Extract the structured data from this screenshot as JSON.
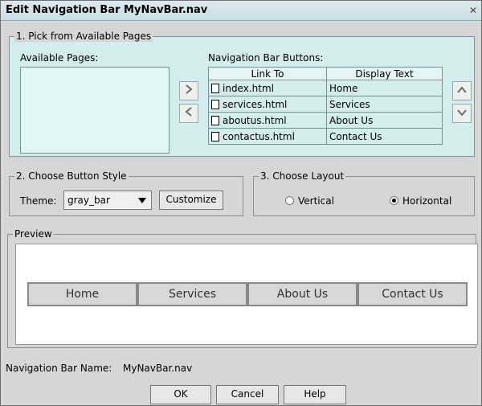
{
  "window": {
    "title": "Edit Navigation Bar MyNavBar.nav",
    "close_glyph": "✕"
  },
  "section1": {
    "legend": "1. Pick from Available Pages",
    "available_label": "Available Pages:",
    "navbar_label": "Navigation Bar Buttons:",
    "columns": [
      "Link To",
      "Display Text"
    ],
    "rows": [
      {
        "link": "index.html",
        "text": "Home"
      },
      {
        "link": "services.html",
        "text": "Services"
      },
      {
        "link": "aboutus.html",
        "text": "About Us"
      },
      {
        "link": "contactus.html",
        "text": "Contact Us"
      }
    ]
  },
  "section2": {
    "legend": "2. Choose Button Style",
    "theme_label": "Theme:",
    "theme_value": "gray_bar",
    "customize_label": "Customize"
  },
  "section3": {
    "legend": "3. Choose Layout",
    "vertical_label": "Vertical",
    "horizontal_label": "Horizontal",
    "selected": "Horizontal"
  },
  "preview": {
    "legend": "Preview",
    "buttons": [
      "Home",
      "Services",
      "About Us",
      "Contact Us"
    ]
  },
  "footer": {
    "name_label": "Navigation Bar Name:",
    "name_value": "MyNavBar.nav",
    "ok": "OK",
    "cancel": "Cancel",
    "help": "Help"
  },
  "colors": {
    "teal_panel": "#d3ecee",
    "window_bg": "#d6d6d6"
  },
  "icons": [
    "move-right-icon",
    "move-left-icon",
    "move-up-icon",
    "move-down-icon",
    "document-icon",
    "dropdown-arrow-icon",
    "close-icon"
  ]
}
